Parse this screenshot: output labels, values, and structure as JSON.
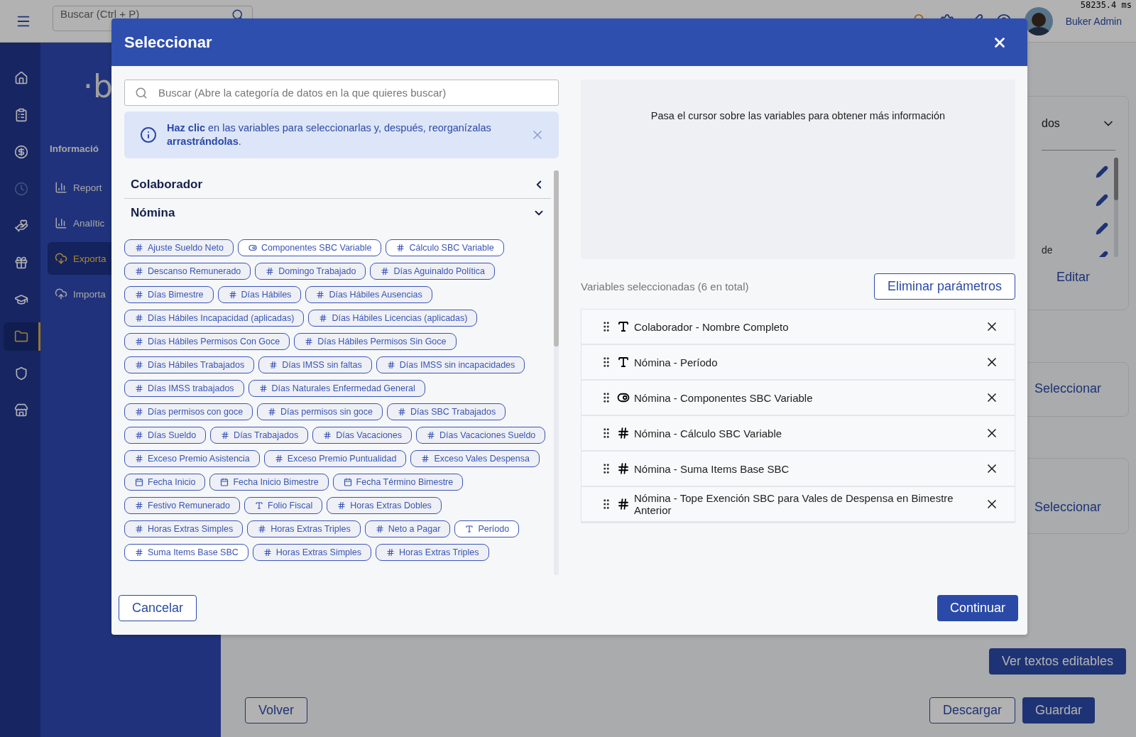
{
  "topbar": {
    "search": {
      "placeholder": "Buscar (Ctrl + P)"
    },
    "user_name": "Buker Admin",
    "timing": "58235.4 ms"
  },
  "rail": [
    {
      "kind": "home",
      "selected": false,
      "disabled": false
    },
    {
      "kind": "clipboard",
      "selected": false,
      "disabled": false
    },
    {
      "kind": "money",
      "selected": false,
      "disabled": false
    },
    {
      "kind": "clock",
      "selected": false,
      "disabled": true
    },
    {
      "kind": "care",
      "selected": false,
      "disabled": false
    },
    {
      "kind": "gift",
      "selected": false,
      "disabled": false
    },
    {
      "kind": "school",
      "selected": false,
      "disabled": false
    },
    {
      "kind": "folder",
      "selected": true,
      "disabled": false
    },
    {
      "kind": "shield",
      "selected": false,
      "disabled": false
    },
    {
      "kind": "store",
      "selected": false,
      "disabled": false
    }
  ],
  "sidebar": {
    "logo": "·b",
    "heading": "Informació",
    "items": [
      {
        "label": "Report",
        "kind": "chart",
        "selected": false
      },
      {
        "label": "Analític",
        "kind": "chart",
        "selected": false
      },
      {
        "label": "Exporta",
        "kind": "download",
        "selected": true
      },
      {
        "label": "Importa",
        "kind": "upload",
        "selected": false
      }
    ]
  },
  "main": {
    "cards": [
      {
        "kind": "fields",
        "title": "dos",
        "expanded": false,
        "rows": [
          {
            "editable": true
          },
          {
            "editable": true
          },
          {
            "editable": true
          },
          {
            "editable": true,
            "label": "de"
          }
        ],
        "action": "Editar"
      },
      {
        "kind": "select",
        "action": "Seleccionar"
      },
      {
        "kind": "select",
        "action": "Seleccionar"
      }
    ],
    "editable_texts_button": "Ver textos editables",
    "back_button": "Volver",
    "download_button": "Descargar",
    "save_button": "Guardar"
  },
  "modal": {
    "title": "Seleccionar",
    "search": {
      "placeholder": "Buscar (Abre la categoría de datos en la que quieres buscar)"
    },
    "notice": "**Haz clic** en las variables para seleccionarlas y, después, reorganízalas **arrastrándolas**.",
    "categories": [
      {
        "name": "Colaborador",
        "expanded": false
      },
      {
        "name": "Nómina",
        "expanded": true,
        "variables": [
          {
            "label": "Ajuste Sueldo Neto",
            "kind": "number",
            "selected": false
          },
          {
            "label": "Componentes SBC Variable",
            "kind": "toggle",
            "selected": true
          },
          {
            "label": "Cálculo SBC Variable",
            "kind": "number",
            "selected": true
          },
          {
            "label": "Descanso Remunerado",
            "kind": "number",
            "selected": false
          },
          {
            "label": "Domingo Trabajado",
            "kind": "number",
            "selected": false
          },
          {
            "label": "Días Aguinaldo Política",
            "kind": "number",
            "selected": false
          },
          {
            "label": "Días Bimestre",
            "kind": "number",
            "selected": false
          },
          {
            "label": "Días Hábiles",
            "kind": "number",
            "selected": false
          },
          {
            "label": "Días Hábiles Ausencias",
            "kind": "number",
            "selected": false
          },
          {
            "label": "Días Hábiles Incapacidad (aplicadas)",
            "kind": "number",
            "selected": false
          },
          {
            "label": "Días Hábiles Licencias (aplicadas)",
            "kind": "number",
            "selected": false
          },
          {
            "label": "Días Hábiles Permisos Con Goce",
            "kind": "number",
            "selected": false
          },
          {
            "label": "Días Hábiles Permisos Sin Goce",
            "kind": "number",
            "selected": false
          },
          {
            "label": "Días Hábiles Trabajados",
            "kind": "number",
            "selected": false
          },
          {
            "label": "Días IMSS sin faltas",
            "kind": "number",
            "selected": false
          },
          {
            "label": "Días IMSS sin incapacidades",
            "kind": "number",
            "selected": false
          },
          {
            "label": "Días IMSS trabajados",
            "kind": "number",
            "selected": false
          },
          {
            "label": "Días Naturales Enfermedad General",
            "kind": "number",
            "selected": false
          },
          {
            "label": "Días permisos con goce",
            "kind": "number",
            "selected": false
          },
          {
            "label": "Días permisos sin goce",
            "kind": "number",
            "selected": false
          },
          {
            "label": "Días SBC Trabajados",
            "kind": "number",
            "selected": false
          },
          {
            "label": "Días Sueldo",
            "kind": "number",
            "selected": false
          },
          {
            "label": "Días Trabajados",
            "kind": "number",
            "selected": false
          },
          {
            "label": "Días Vacaciones",
            "kind": "number",
            "selected": false
          },
          {
            "label": "Días Vacaciones Sueldo",
            "kind": "number",
            "selected": false
          },
          {
            "label": "Exceso Premio Asistencia",
            "kind": "number",
            "selected": false
          },
          {
            "label": "Exceso Premio Puntualidad",
            "kind": "number",
            "selected": false
          },
          {
            "label": "Exceso Vales Despensa",
            "kind": "number",
            "selected": false
          },
          {
            "label": "Fecha Inicio",
            "kind": "date",
            "selected": false
          },
          {
            "label": "Fecha Inicio Bimestre",
            "kind": "date",
            "selected": false
          },
          {
            "label": "Fecha Término Bimestre",
            "kind": "date",
            "selected": false
          },
          {
            "label": "Festivo Remunerado",
            "kind": "number",
            "selected": false
          },
          {
            "label": "Folio Fiscal",
            "kind": "text",
            "selected": false
          },
          {
            "label": "Horas Extras Dobles",
            "kind": "number",
            "selected": false
          },
          {
            "label": "Horas Extras Simples",
            "kind": "number",
            "selected": false
          },
          {
            "label": "Horas Extras Triples",
            "kind": "number",
            "selected": false
          },
          {
            "label": "Neto a Pagar",
            "kind": "number",
            "selected": false
          },
          {
            "label": "Período",
            "kind": "text",
            "selected": true
          },
          {
            "label": "Suma Items Base SBC",
            "kind": "number",
            "selected": true
          },
          {
            "label": "Horas Extras Simples",
            "kind": "number",
            "selected": false
          },
          {
            "label": "Horas Extras Triples",
            "kind": "number",
            "selected": false
          }
        ]
      }
    ],
    "hint": "Pasa el cursor sobre las variables para obtener más información",
    "selected_label": "Variables seleccionadas (6 en total)",
    "clear_button": "Eliminar parámetros",
    "selected_variables": [
      {
        "label": "Colaborador - Nombre Completo",
        "kind": "text"
      },
      {
        "label": "Nómina - Período",
        "kind": "text"
      },
      {
        "label": "Nómina - Componentes SBC Variable",
        "kind": "toggle"
      },
      {
        "label": "Nómina - Cálculo SBC Variable",
        "kind": "number"
      },
      {
        "label": "Nómina - Suma Items Base SBC",
        "kind": "number"
      },
      {
        "label": "Nómina - Tope Exención SBC para Vales de Despensa en Bimestre Anterior",
        "kind": "number"
      }
    ],
    "cancel_button": "Cancelar",
    "confirm_button": "Continuar"
  }
}
